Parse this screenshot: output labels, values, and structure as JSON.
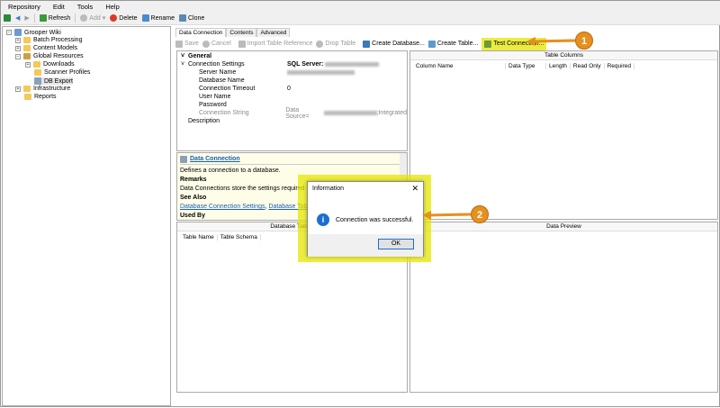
{
  "menu": [
    "Repository",
    "Edit",
    "Tools",
    "Help"
  ],
  "toolbar": {
    "refresh": "Refresh",
    "add": "Add",
    "delete": "Delete",
    "rename": "Rename",
    "clone": "Clone"
  },
  "tree": {
    "root": "Grooper Wiki",
    "items": [
      "Batch Processing",
      "Content Models",
      "Global Resources",
      "Downloads",
      "Scanner Profiles",
      "DB Export",
      "Infrastructure",
      "Reports"
    ]
  },
  "tabs": [
    "Data Connection",
    "Contents",
    "Advanced"
  ],
  "actions": {
    "save": "Save",
    "cancel": "Cancel",
    "import": "Import Table Reference",
    "drop": "Drop Table",
    "create_db": "Create Database...",
    "create_table": "Create Table...",
    "test": "Test Connection..."
  },
  "props": {
    "general": "General",
    "conn_settings": "Connection Settings",
    "conn_settings_value": "SQL Server:",
    "server": "Server Name",
    "database": "Database Name",
    "timeout": "Connection Timeout",
    "timeout_value": "0",
    "user": "User Name",
    "password": "Password",
    "conn_string": "Connection String",
    "conn_string_value_prefix": "Data Source=",
    "conn_string_value_suffix": ";Integrated",
    "description": "Description"
  },
  "help": {
    "title": "Data Connection",
    "desc": "Defines a connection to a database.",
    "remarks": "Remarks",
    "remarks_text": "Data Connections store the settings required for",
    "see_also": "See Also",
    "link1": "Database Connection Settings",
    "link2": "Database Table",
    "used_by": "Used By"
  },
  "db_tables": {
    "title": "Database Tables",
    "cols": [
      "Table Name",
      "Table Schema"
    ]
  },
  "table_columns": {
    "title": "Table Columns",
    "cols": [
      "Column Name",
      "Data Type",
      "Length",
      "Read Only",
      "Required"
    ]
  },
  "preview": {
    "title": "Data Preview"
  },
  "dialog": {
    "title": "Information",
    "message": "Connection was successful.",
    "ok": "OK"
  },
  "callouts": [
    "1",
    "2"
  ],
  "colors": {
    "highlight": "#e6e600",
    "callout": "#e6901f"
  }
}
